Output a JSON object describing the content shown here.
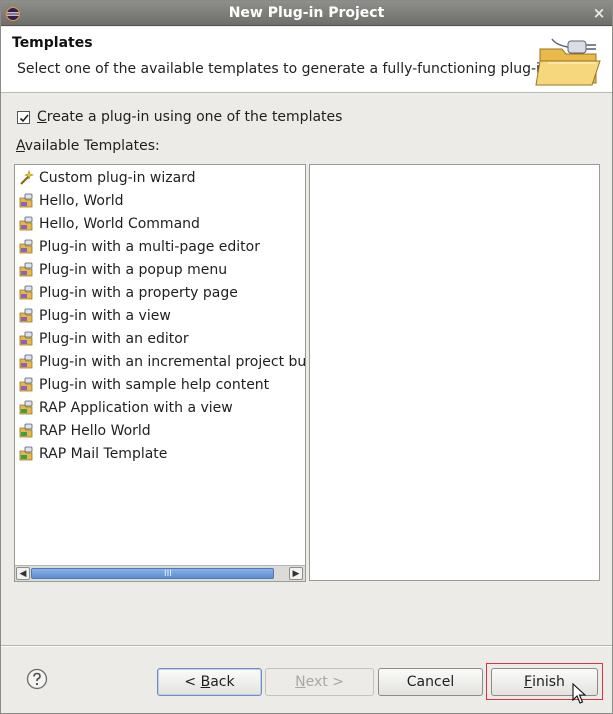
{
  "window": {
    "title": "New Plug-in Project",
    "app_icon": "eclipse-icon",
    "close_glyph": "×"
  },
  "banner": {
    "heading": "Templates",
    "description": "Select one of the available templates to generate a fully-functioning plug-in.",
    "icon": "folder-plugin-wizard-icon"
  },
  "use_template": {
    "checked": true,
    "label_mnemonic": "C",
    "label_rest": "reate a plug-in using one of the templates"
  },
  "available_templates": {
    "label_mnemonic": "A",
    "label_rest": "vailable Templates:",
    "items": [
      {
        "label": "Custom plug-in wizard",
        "icon": "wand-icon"
      },
      {
        "label": "Hello, World",
        "icon": "plugin-template-icon"
      },
      {
        "label": "Hello, World Command",
        "icon": "plugin-template-icon"
      },
      {
        "label": "Plug-in with a multi-page editor",
        "icon": "plugin-template-icon"
      },
      {
        "label": "Plug-in with a popup menu",
        "icon": "plugin-template-icon"
      },
      {
        "label": "Plug-in with a property page",
        "icon": "plugin-template-icon"
      },
      {
        "label": "Plug-in with a view",
        "icon": "plugin-template-icon"
      },
      {
        "label": "Plug-in with an editor",
        "icon": "plugin-template-icon"
      },
      {
        "label": "Plug-in with an incremental project builder",
        "icon": "plugin-template-icon"
      },
      {
        "label": "Plug-in with sample help content",
        "icon": "plugin-template-icon"
      },
      {
        "label": "RAP Application with a view",
        "icon": "rap-template-icon"
      },
      {
        "label": "RAP Hello World",
        "icon": "rap-template-icon"
      },
      {
        "label": "RAP Mail Template",
        "icon": "rap-template-icon"
      }
    ],
    "scroll_grip": "III"
  },
  "buttons": {
    "back_prefix": "< ",
    "back_mnemonic": "B",
    "back_rest": "ack",
    "next_mnemonic": "N",
    "next_rest": "ext >",
    "cancel": "Cancel",
    "finish_mnemonic": "F",
    "finish_rest": "inish",
    "help_icon": "help-icon"
  },
  "colors": {
    "accent_highlight": "#d9373f",
    "scroll_thumb": "#5b8ed3"
  }
}
